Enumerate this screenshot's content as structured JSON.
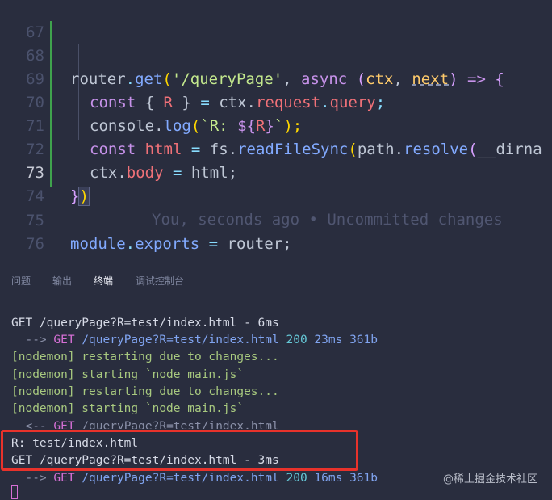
{
  "editor": {
    "line_numbers": [
      "67",
      "68",
      "69",
      "70",
      "71",
      "72",
      "73",
      "74",
      "75",
      "76"
    ],
    "l68": {
      "a": "router",
      "b": ".",
      "c": "get",
      "d": "(",
      "e": "'/queryPage'",
      "f": ", ",
      "g": "async",
      "h": " (",
      "i": "ctx",
      "j": ", ",
      "k": "next",
      "l": ") ",
      "m": "=>",
      "n": " {"
    },
    "l69": {
      "a": "const",
      "b": " { ",
      "c": "R",
      "d": " } ",
      "e": "=",
      "f": " ctx.",
      "g": "request",
      "h": ".",
      "i": "query",
      "j": ";"
    },
    "l70": {
      "a": "console.",
      "b": "log",
      "c": "(",
      "d": "`R: ",
      "e": "${",
      "f": "R",
      "g": "}",
      "h": "`",
      "i": ");"
    },
    "l71": {
      "a": "const",
      "b": " ",
      "c": "html",
      "d": " ",
      "e": "=",
      "f": " fs.",
      "g": "readFileSync",
      "h": "(",
      "i": "path.",
      "j": "resolve",
      "k": "(",
      "l": "__dirna"
    },
    "l72": {
      "a": "ctx.",
      "b": "body",
      "c": " ",
      "d": "=",
      "e": " html;"
    },
    "l73": {
      "a": "}",
      "b": ")"
    },
    "blame": "You, seconds ago • Uncommitted changes",
    "l75": {
      "a": "module",
      "b": ".",
      "c": "exports",
      "d": " ",
      "e": "=",
      "f": " router;"
    }
  },
  "panel": {
    "tabs": [
      "问题",
      "输出",
      "终端",
      "调试控制台"
    ],
    "active_tab": "终端"
  },
  "terminal": {
    "t1": "GET /queryPage?R=test/index.html - 6ms",
    "t2": {
      "arrow": "  --> ",
      "method": "GET",
      "path": " /queryPage?R=test/index.html",
      "status": " 200",
      "time": " 23ms",
      "size": " 361b"
    },
    "t3": "[nodemon] restarting due to changes...",
    "t4": "[nodemon] starting `node main.js`",
    "t5": "[nodemon] restarting due to changes...",
    "t6": "[nodemon] starting `node main.js`",
    "t7": {
      "arrow": "  <-- ",
      "method": "GET",
      "path": " /queryPage?R=test/index.html"
    },
    "t8": "R: test/index.html",
    "t9": "GET /queryPage?R=test/index.html - 3ms",
    "t10": {
      "arrow": "  --> ",
      "method": "GET",
      "path": " /queryPage?R=test/index.html",
      "status": " 200",
      "time": " 16ms",
      "size": " 361b"
    }
  },
  "watermark": "@稀土掘金技术社区",
  "colors": {
    "background": "#292d3e",
    "git_modified_bar": "#3fa34d",
    "highlight_box": "#e8322b"
  }
}
